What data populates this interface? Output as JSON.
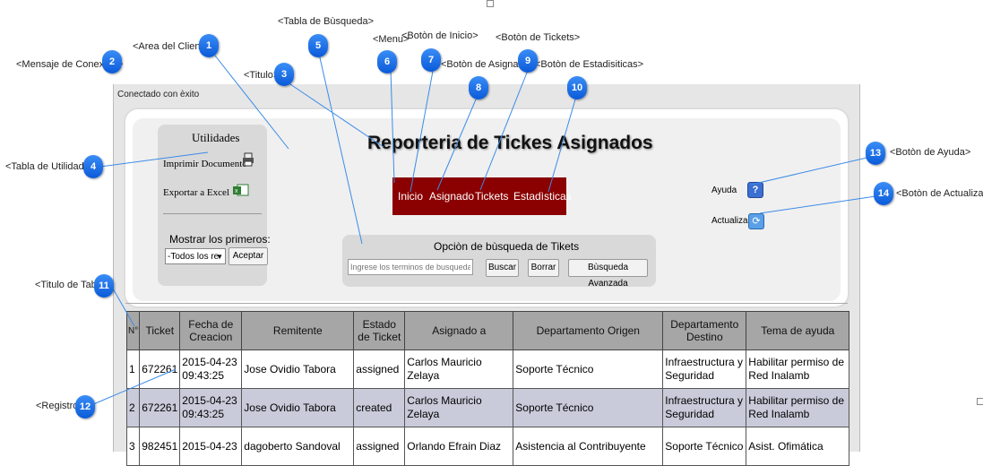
{
  "callouts": {
    "c1": "<Area del Cliente>",
    "c2": "<Mensaje de Conexiòn>",
    "c3": "<Titulo>",
    "c4": "<Tabla de Utilidades>",
    "c5": "<Tabla de Bùsqueda>",
    "c6": "<Menu>",
    "c7": "<Botòn de Inicio>",
    "c8": "<Botòn de Asignado>",
    "c9": "<Botòn de Tickets>",
    "c10": "<Botòn de Estadisiticas>",
    "c11": "<Titulo de Tabla>",
    "c12": "<Registro>",
    "c13": "<Botòn de Ayuda>",
    "c14": "<Botòn de Actualizar>"
  },
  "badges": [
    "1",
    "2",
    "3",
    "4",
    "5",
    "6",
    "7",
    "8",
    "9",
    "10",
    "11",
    "12",
    "13",
    "14"
  ],
  "connection_message": "Conectado con èxito",
  "page_title": "Reporteria de Tickes Asignados",
  "utilities": {
    "title": "Utilidades",
    "print_label": "Imprimir Documento",
    "export_label": "Exportar a Excel",
    "show_first_label": "Mostrar los primeros:",
    "select_value": "-Todos los re",
    "accept_button": "Aceptar"
  },
  "menu": {
    "inicio": "Inicio",
    "asignado": "Asignado",
    "tickets": "Tickets",
    "estadisticas": "Estadìsticas"
  },
  "search": {
    "title": "Opciòn de bùsqueda de Tikets",
    "placeholder": "Ingrese los terminos de busqueda",
    "search_button": "Buscar",
    "clear_button": "Borrar",
    "advanced_button": "Bùsqueda Avanzada"
  },
  "side": {
    "help_label": "Ayuda",
    "refresh_label": "Actualizar"
  },
  "table": {
    "headers": [
      "N°",
      "Ticket",
      "Fecha de Creacion",
      "Remitente",
      "Estado de Ticket",
      "Asignado a",
      "Departamento Origen",
      "Departamento Destino",
      "Tema de ayuda"
    ],
    "rows": [
      [
        "1",
        "672261",
        "2015-04-23 09:43:25",
        "Jose Ovidio Tabora",
        "assigned",
        "Carlos Mauricio Zelaya",
        "Soporte Técnico",
        "Infraestructura y Seguridad",
        "Habilitar permiso de Red Inalamb"
      ],
      [
        "2",
        "672261",
        "2015-04-23 09:43:25",
        "Jose Ovidio Tabora",
        "created",
        "Carlos Mauricio Zelaya",
        "Soporte Técnico",
        "Infraestructura y Seguridad",
        "Habilitar permiso de Red Inalamb"
      ],
      [
        "3",
        "982451",
        "2015-04-23",
        "dagoberto Sandoval",
        "assigned",
        "Orlando Efrain Diaz",
        "Asistencia al Contribuyente",
        "Soporte Técnico",
        "Asist. Ofimática"
      ]
    ]
  },
  "colors": {
    "menu_bg": "#8b0000",
    "badge_blue": "#0a5ad8",
    "header_bg": "#a6a6a6",
    "alt_row": "#c9cbda"
  }
}
